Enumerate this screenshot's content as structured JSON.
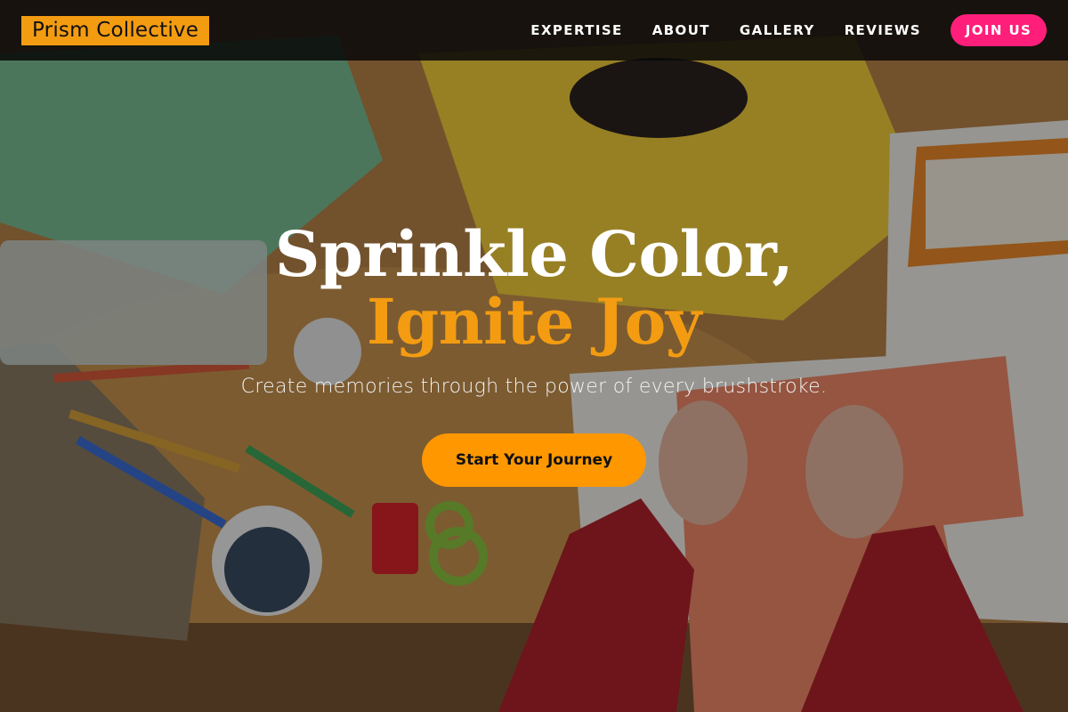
{
  "brand": {
    "name": "Prism Collective"
  },
  "nav": {
    "links": [
      "EXPERTISE",
      "ABOUT",
      "GALLERY",
      "REVIEWS"
    ],
    "cta_label": "JOIN US"
  },
  "hero": {
    "headline_line1": "Sprinkle Color,",
    "headline_line2": "Ignite Joy",
    "subtitle": "Create memories through the power of every brushstroke.",
    "button_label": "Start Your Journey"
  },
  "colors": {
    "accent_orange": "#f39c12",
    "accent_pink": "#ff1f7a",
    "cta_orange": "#ff9800"
  }
}
